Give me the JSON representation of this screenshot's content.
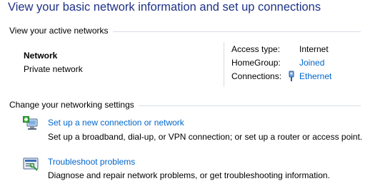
{
  "title": "View your basic network information and set up connections",
  "active_networks": {
    "header": "View your active networks",
    "network_name": "Network",
    "network_type": "Private network",
    "details": {
      "access_type_label": "Access type:",
      "access_type_value": "Internet",
      "homegroup_label": "HomeGroup:",
      "homegroup_value": "Joined",
      "connections_label": "Connections:",
      "connections_value": "Ethernet"
    }
  },
  "settings": {
    "header": "Change your networking settings",
    "tasks": [
      {
        "title": "Set up a new connection or network",
        "description": "Set up a broadband, dial-up, or VPN connection; or set up a router or access point.",
        "icon": "new-connection-icon"
      },
      {
        "title": "Troubleshoot problems",
        "description": "Diagnose and repair network problems, or get troubleshooting information.",
        "icon": "troubleshoot-icon"
      }
    ]
  },
  "colors": {
    "title": "#1e3287",
    "link": "#0066cc",
    "rule": "#d6dde6"
  }
}
